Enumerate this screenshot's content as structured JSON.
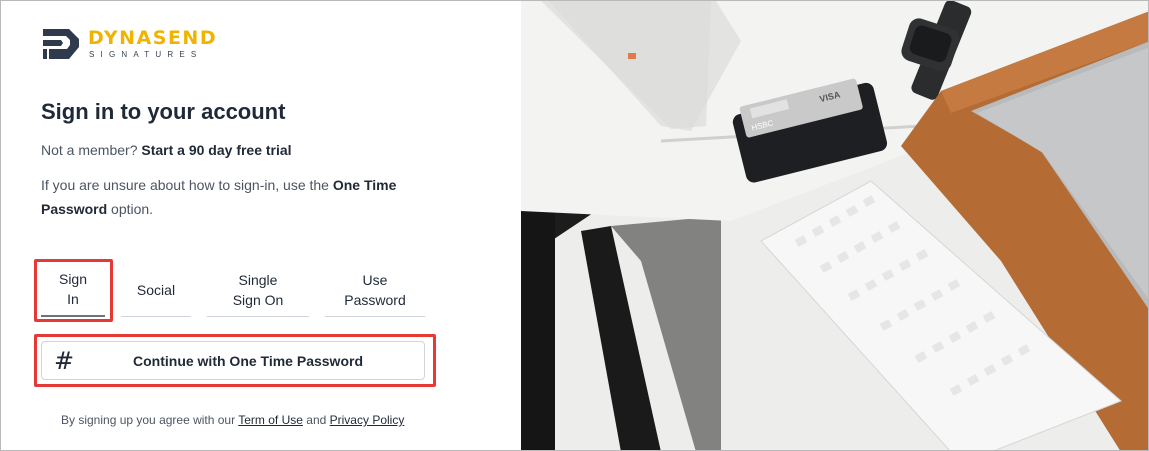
{
  "brand": {
    "name": "DYNASEND",
    "sub": "SIGNATURES",
    "accent": "#f0b400"
  },
  "title": "Sign in to your account",
  "member": {
    "prefix": "Not a member?",
    "link": "Start a 90 day free trial"
  },
  "hint": {
    "prefix": "If you are unsure about how to sign-in, use the",
    "bold": "One Time Password",
    "suffix": "option."
  },
  "tabs": [
    {
      "label_1": "Sign",
      "label_2": "In"
    },
    {
      "label_1": "Social"
    },
    {
      "label_1": "Single",
      "label_2": "Sign On"
    },
    {
      "label_1": "Use",
      "label_2": "Password"
    }
  ],
  "otp_button": {
    "icon": "#",
    "label": "Continue with One Time Password"
  },
  "terms": {
    "prefix": "By signing up you agree with our",
    "terms_link": "Term of Use",
    "and": "and",
    "privacy_link": "Privacy Policy"
  },
  "highlight_color": "#e53935",
  "hero": {
    "card_brand": "VISA",
    "card_bank": "HSBC"
  }
}
